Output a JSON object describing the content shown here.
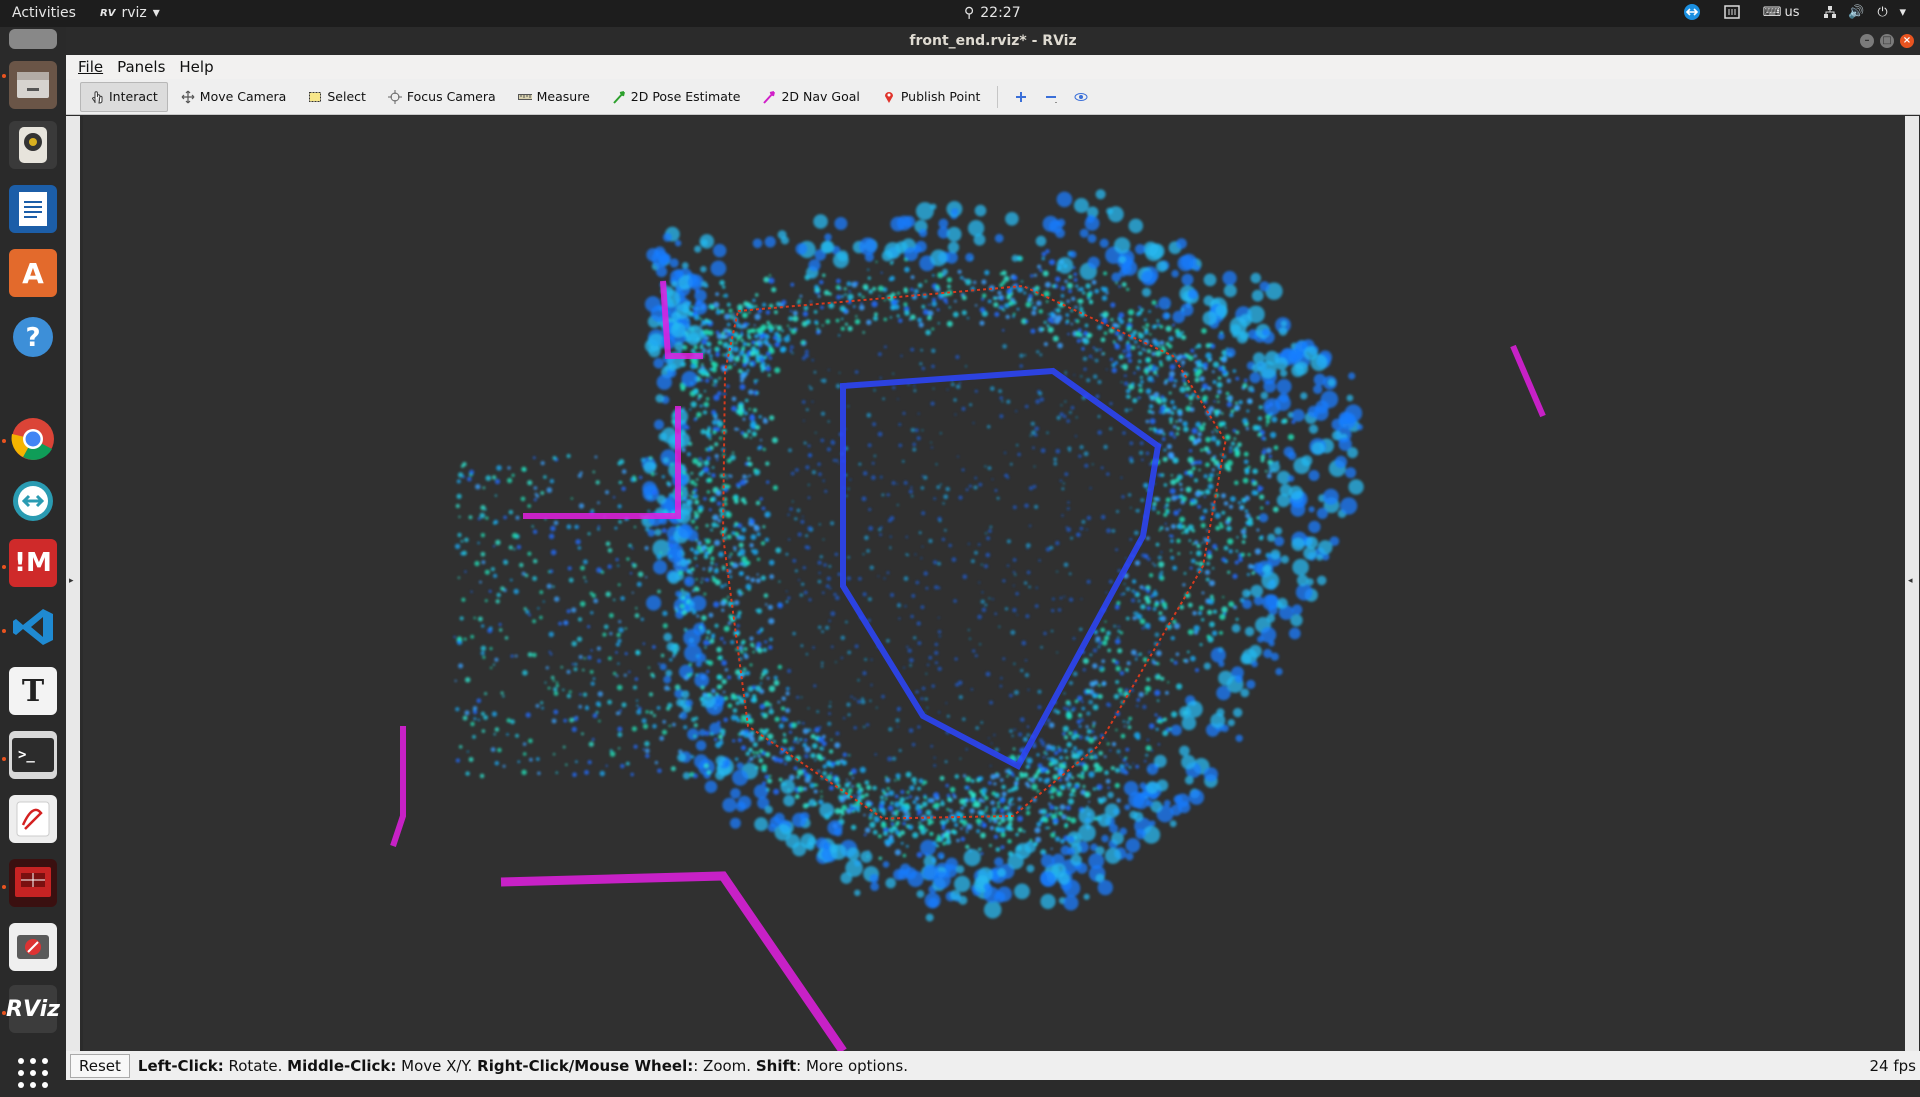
{
  "topbar": {
    "activities": "Activities",
    "app_name": "rviz",
    "app_badge": "RV",
    "clock": "22:27",
    "keyboard_layout": "us"
  },
  "window": {
    "title": "front_end.rviz* - RViz"
  },
  "menu": {
    "file": "File",
    "panels": "Panels",
    "help": "Help"
  },
  "toolbar": {
    "interact": "Interact",
    "move_camera": "Move Camera",
    "select": "Select",
    "focus_camera": "Focus Camera",
    "measure": "Measure",
    "pose_estimate": "2D Pose Estimate",
    "nav_goal": "2D Nav Goal",
    "publish_point": "Publish Point"
  },
  "dock": {
    "rviz_label": "RViz",
    "text_editor_label": "T",
    "mm_label": "!M"
  },
  "status": {
    "reset": "Reset",
    "left_click": "Left-Click:",
    "left_desc": " Rotate. ",
    "middle_click": "Middle-Click:",
    "middle_desc": " Move X/Y. ",
    "right_click": "Right-Click/Mouse Wheel:",
    "right_desc": ": Zoom. ",
    "shift": "Shift",
    "shift_desc": ": More options.",
    "fps": "24 fps"
  },
  "colors": {
    "accent": "#e95420",
    "cloud_cyan": "#2ee6d0",
    "cloud_blue": "#1e6bff",
    "cloud_magenta": "#e21ee0",
    "trajectory": "#d63a1e"
  }
}
